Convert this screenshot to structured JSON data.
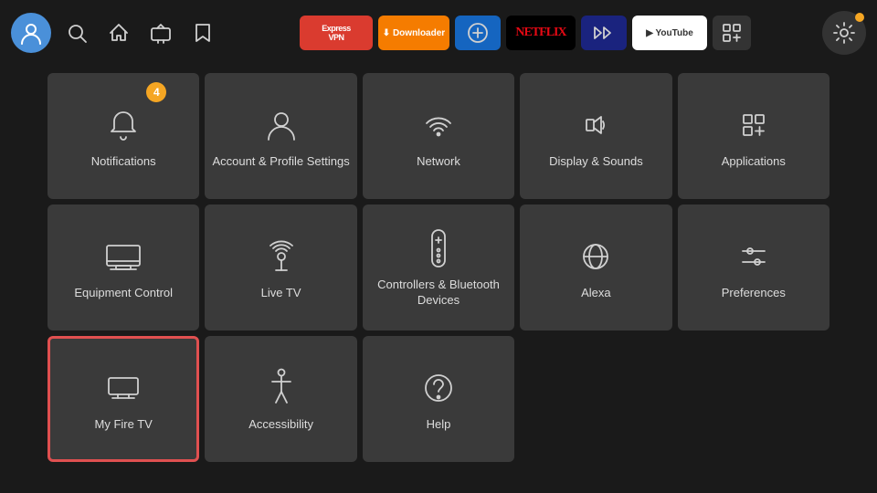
{
  "topbar": {
    "avatar_label": "👤",
    "nav_icons": [
      "🔍",
      "🏠",
      "📺",
      "🔖"
    ],
    "apps": [
      {
        "name": "ExpressVPN",
        "class": "expressvpn",
        "label": "Express VPN"
      },
      {
        "name": "Downloader",
        "class": "downloader",
        "label": "⬇ Downloader"
      },
      {
        "name": "Blue",
        "class": "blue-icon",
        "label": "↗"
      },
      {
        "name": "Netflix",
        "class": "netflix",
        "label": "NETFLIX"
      },
      {
        "name": "Kodi",
        "class": "kodi",
        "label": "⚡"
      },
      {
        "name": "YouTube",
        "class": "youtube",
        "label": "▶ YouTube"
      },
      {
        "name": "Grid",
        "class": "grid-btn",
        "label": "⊞"
      }
    ],
    "settings_label": "⚙"
  },
  "grid": {
    "items": [
      {
        "id": "notifications",
        "label": "Notifications",
        "badge": "4",
        "icon_type": "bell"
      },
      {
        "id": "account-profile",
        "label": "Account & Profile Settings",
        "icon_type": "person"
      },
      {
        "id": "network",
        "label": "Network",
        "icon_type": "wifi"
      },
      {
        "id": "display-sounds",
        "label": "Display & Sounds",
        "icon_type": "speaker"
      },
      {
        "id": "applications",
        "label": "Applications",
        "icon_type": "apps"
      },
      {
        "id": "equipment-control",
        "label": "Equipment Control",
        "icon_type": "monitor"
      },
      {
        "id": "live-tv",
        "label": "Live TV",
        "icon_type": "antenna"
      },
      {
        "id": "controllers-bluetooth",
        "label": "Controllers & Bluetooth Devices",
        "icon_type": "remote"
      },
      {
        "id": "alexa",
        "label": "Alexa",
        "icon_type": "alexa"
      },
      {
        "id": "preferences",
        "label": "Preferences",
        "icon_type": "sliders"
      },
      {
        "id": "my-fire-tv",
        "label": "My Fire TV",
        "icon_type": "firetv",
        "selected": true
      },
      {
        "id": "accessibility",
        "label": "Accessibility",
        "icon_type": "accessibility"
      },
      {
        "id": "help",
        "label": "Help",
        "icon_type": "help"
      }
    ]
  }
}
